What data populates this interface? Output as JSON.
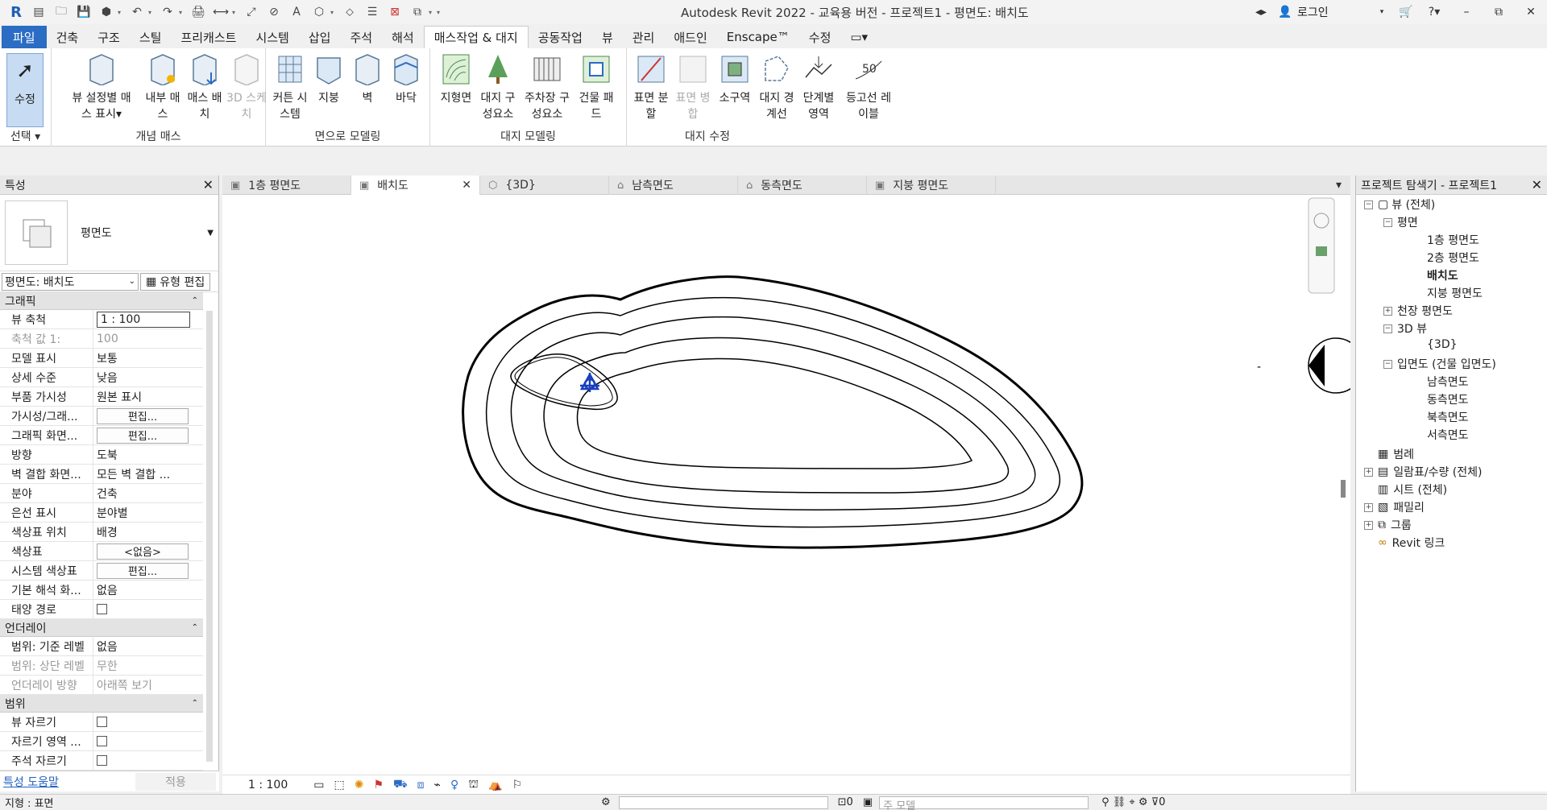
{
  "window": {
    "title": "Autodesk Revit 2022 - 교육용 버전 - 프로젝트1 - 평면도: 배치도",
    "login": "로그인",
    "min": "–",
    "restore": "⧉",
    "close": "✕"
  },
  "qat": [
    "R",
    "🗀",
    "💾",
    "↶",
    "↷",
    "🖨",
    "A"
  ],
  "tabs": [
    "파일",
    "건축",
    "구조",
    "스틸",
    "프리캐스트",
    "시스템",
    "삽입",
    "주석",
    "해석",
    "매스작업 & 대지",
    "공동작업",
    "뷰",
    "관리",
    "애드인",
    "Enscape™",
    "수정"
  ],
  "ribbon": {
    "modify": {
      "label": "수정",
      "panel": "선택 ▾"
    },
    "conceptual": {
      "panel": "개념 매스",
      "buttons": [
        "뷰 설정별 매스 표시▾",
        "내부 매스",
        "매스 배치",
        "3D 스케치"
      ]
    },
    "face": {
      "panel": "면으로 모델링",
      "buttons": [
        "커튼 시스템",
        "지붕",
        "벽",
        "바닥"
      ]
    },
    "site": {
      "panel": "대지 모델링",
      "buttons": [
        "지형면",
        "대지 구성요소",
        "주차장 구성요소",
        "건물 패드"
      ]
    },
    "sitemod": {
      "panel": "대지 수정",
      "buttons": [
        "표면 분할",
        "표면 병합",
        "소구역",
        "대지 경계선",
        "단계별 영역",
        "등고선 레이블"
      ]
    }
  },
  "properties": {
    "title": "특성",
    "type_name": "평면도",
    "instance": "평면도: 배치도",
    "edit_type": "유형 편집",
    "groups": [
      {
        "name": "그래픽",
        "rows": [
          [
            "뷰 축척",
            "1 : 100"
          ],
          [
            "축척 값    1:",
            "100"
          ],
          [
            "모델 표시",
            "보통"
          ],
          [
            "상세 수준",
            "낮음"
          ],
          [
            "부품 가시성",
            "원본 표시"
          ],
          [
            "가시성/그래...",
            "편집..."
          ],
          [
            "그래픽 화면...",
            "편집..."
          ],
          [
            "방향",
            "도북"
          ],
          [
            "벽 결합 화면...",
            "모든 벽 결합 ..."
          ],
          [
            "분야",
            "건축"
          ],
          [
            "은선 표시",
            "분야별"
          ],
          [
            "색상표 위치",
            "배경"
          ],
          [
            "색상표",
            "<없음>"
          ],
          [
            "시스템 색상표",
            "편집..."
          ],
          [
            "기본 해석 화...",
            "없음"
          ],
          [
            "태양 경로",
            ""
          ]
        ]
      },
      {
        "name": "언더레이",
        "rows": [
          [
            "범위: 기준 레벨",
            "없음"
          ],
          [
            "범위: 상단 레벨",
            "무한"
          ],
          [
            "언더레이 방향",
            "아래쪽 보기"
          ]
        ]
      },
      {
        "name": "범위",
        "rows": [
          [
            "뷰 자르기",
            ""
          ],
          [
            "자르기 영역 ...",
            ""
          ],
          [
            "주석 자르기",
            ""
          ]
        ]
      }
    ],
    "help": "특성 도움말",
    "apply": "적용"
  },
  "view_tabs": [
    "1층 평면도",
    "배치도",
    "{3D}",
    "남측면도",
    "동측면도",
    "지붕 평면도"
  ],
  "view_scale": "1 : 100",
  "browser": {
    "title": "프로젝트 탐색기 - 프로젝트1",
    "items": [
      "뷰 (전체)",
      "평면",
      "1층 평면도",
      "2층 평면도",
      "배치도",
      "지붕 평면도",
      "천장 평면도",
      "3D 뷰",
      "{3D}",
      "입면도 (건물 입면도)",
      "남측면도",
      "동측면도",
      "북측면도",
      "서측면도",
      "범례",
      "일람표/수량 (전체)",
      "시트 (전체)",
      "패밀리",
      "그룹",
      "Revit 링크"
    ]
  },
  "status": {
    "left": "지형 : 표면",
    "mid": "주 모델"
  },
  "elevation_marker": {
    "left": "-",
    "right": "-"
  }
}
